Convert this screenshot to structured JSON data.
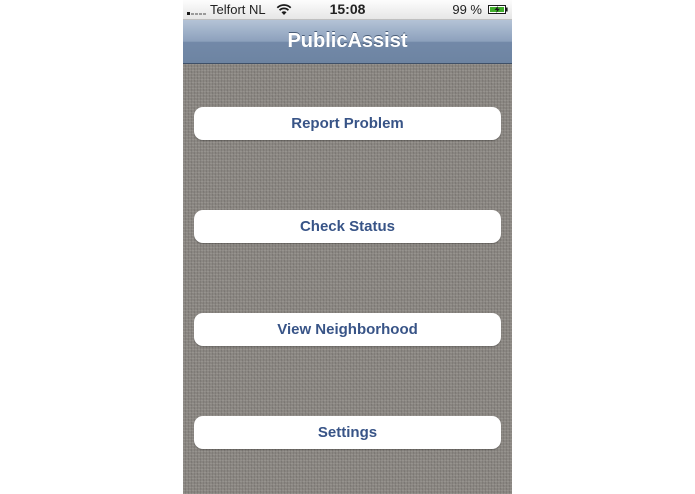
{
  "status_bar": {
    "carrier": "Telfort NL",
    "time": "15:08",
    "battery": "99 %",
    "signal_bars": 1,
    "icons": [
      "signal-icon",
      "wifi-icon",
      "battery-charging-icon"
    ]
  },
  "nav": {
    "title": "PublicAssist"
  },
  "menu": {
    "report_problem": "Report Problem",
    "check_status": "Check Status",
    "view_neighborhood": "View Neighborhood",
    "settings": "Settings"
  },
  "colors": {
    "nav_bar": "#8ca0bc",
    "button_text": "#385487",
    "background": "#8b8782"
  }
}
